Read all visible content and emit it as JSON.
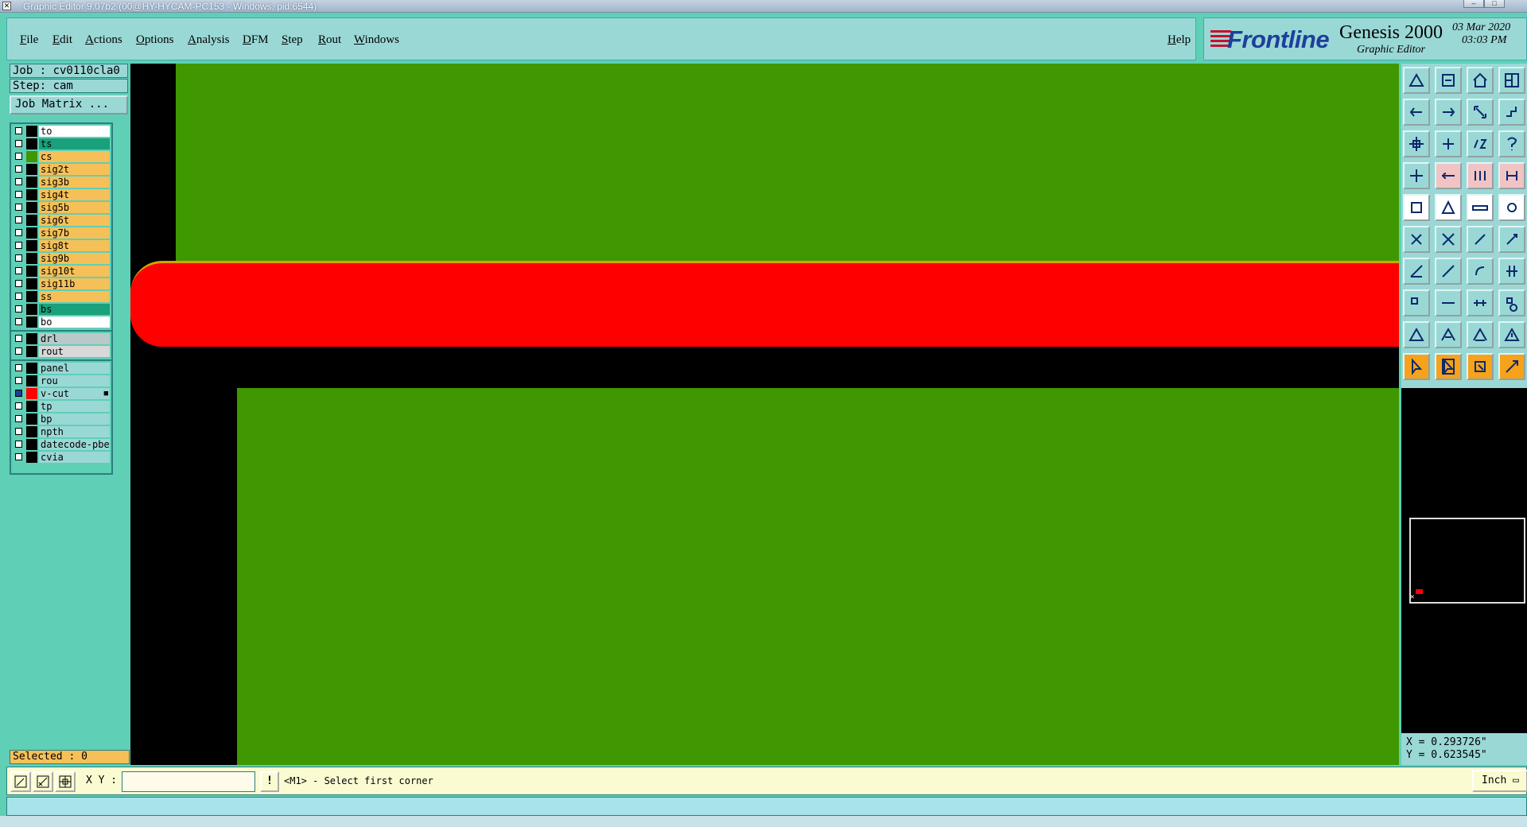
{
  "window": {
    "title": "Graphic Editor 9.07b2 (00@HY-HYCAM-PC153 - Windows, pid:6544)"
  },
  "menu": {
    "items": [
      "File",
      "Edit",
      "Actions",
      "Options",
      "Analysis",
      "DFM",
      "Step",
      "Rout",
      "Windows"
    ],
    "help": "Help"
  },
  "brand": {
    "logo": "Frontline",
    "product": "Genesis 2000",
    "subtitle": "Graphic Editor",
    "date": "03 Mar 2020",
    "time": "03:03 PM"
  },
  "job": {
    "job_label": "Job : cv0110cla0",
    "step_label": "Step: cam",
    "matrix_button": "Job Matrix ..."
  },
  "layers": {
    "board": [
      {
        "name": "to",
        "color": "#ffffff",
        "swatch": "#000000"
      },
      {
        "name": "ts",
        "color": "#1aa07a",
        "swatch": "#000000"
      },
      {
        "name": "cs",
        "color": "#f6c058",
        "swatch": "#3f9701"
      },
      {
        "name": "sig2t",
        "color": "#f6c058",
        "swatch": "#000000"
      },
      {
        "name": "sig3b",
        "color": "#f6c058",
        "swatch": "#000000"
      },
      {
        "name": "sig4t",
        "color": "#f6c058",
        "swatch": "#000000"
      },
      {
        "name": "sig5b",
        "color": "#f6c058",
        "swatch": "#000000"
      },
      {
        "name": "sig6t",
        "color": "#f6c058",
        "swatch": "#000000"
      },
      {
        "name": "sig7b",
        "color": "#f6c058",
        "swatch": "#000000"
      },
      {
        "name": "sig8t",
        "color": "#f6c058",
        "swatch": "#000000"
      },
      {
        "name": "sig9b",
        "color": "#f6c058",
        "swatch": "#000000"
      },
      {
        "name": "sig10t",
        "color": "#f6c058",
        "swatch": "#000000"
      },
      {
        "name": "sig11b",
        "color": "#f6c058",
        "swatch": "#000000"
      },
      {
        "name": "ss",
        "color": "#f6c058",
        "swatch": "#000000"
      },
      {
        "name": "bs",
        "color": "#1aa07a",
        "swatch": "#000000"
      },
      {
        "name": "bo",
        "color": "#ffffff",
        "swatch": "#000000"
      }
    ],
    "drill": [
      {
        "name": "drl",
        "color": "#b9c9c9",
        "swatch": "#000000"
      },
      {
        "name": "rout",
        "color": "#d8d8d8",
        "swatch": "#000000"
      }
    ],
    "misc": [
      {
        "name": "panel",
        "color": "#9ad8d6",
        "swatch": "#000000"
      },
      {
        "name": "rou",
        "color": "#9ad8d6",
        "swatch": "#000000"
      },
      {
        "name": "v-cut",
        "color": "#9ad8d6",
        "swatch": "#ff0000",
        "checked": true,
        "marker": "■"
      },
      {
        "name": "tp",
        "color": "#9ad8d6",
        "swatch": "#000000"
      },
      {
        "name": "bp",
        "color": "#9ad8d6",
        "swatch": "#000000"
      },
      {
        "name": "npth",
        "color": "#9ad8d6",
        "swatch": "#000000"
      },
      {
        "name": "datecode-pbe",
        "color": "#9ad8d6",
        "swatch": "#000000"
      },
      {
        "name": "cvia",
        "color": "#9ad8d6",
        "swatch": "#000000"
      }
    ]
  },
  "selected": "Selected : 0",
  "coords": {
    "x": "X = 0.293726\"",
    "y": "Y = 0.623545\""
  },
  "bottom": {
    "xy_label": "X Y :",
    "xy_value": "",
    "warn": "!",
    "prompt": "<M1> - Select first corner",
    "units": "Inch"
  },
  "colors": {
    "board_green": "#3f9701",
    "vcut_red": "#ff0000",
    "panel_teal": "#5fcfb6",
    "menu_bg": "#9ad8d6"
  }
}
